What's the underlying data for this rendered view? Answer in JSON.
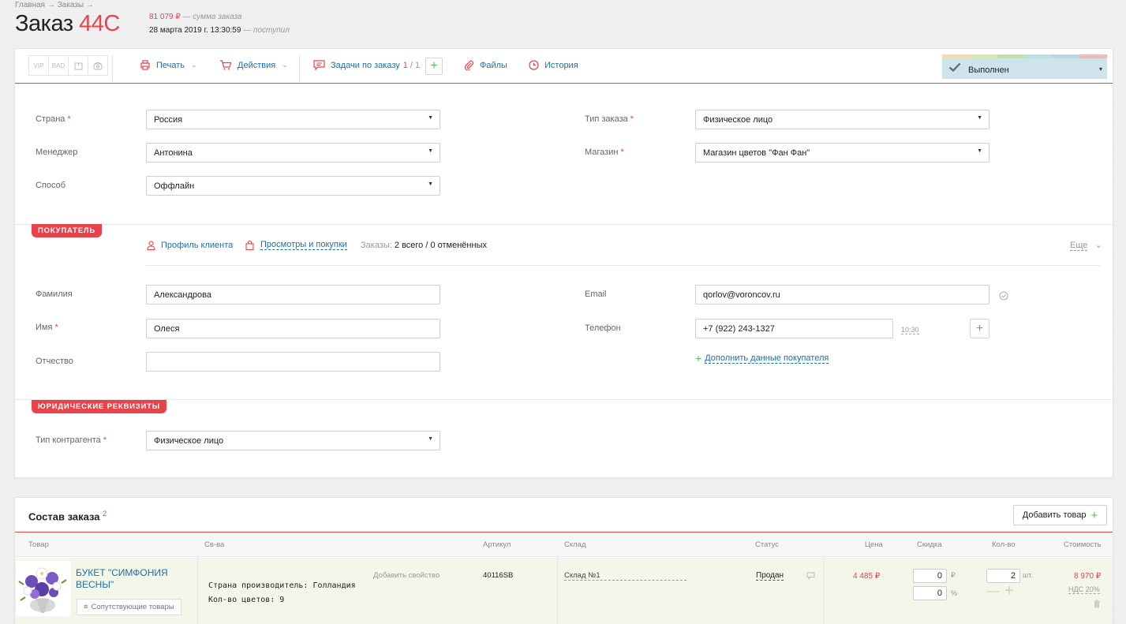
{
  "header": {
    "breadcrumb": "Главная → Заказы →",
    "title_prefix": "Заказ",
    "order_number": "44С",
    "order_sum": "81 079 ₽",
    "order_sum_note": "— сумма заказа",
    "created_date": "28 марта 2019 г. 13:30:59",
    "created_note": "— поступил"
  },
  "toolbar": {
    "badges": [
      "VIP",
      "BAD",
      "",
      ""
    ],
    "print_label": "Печать",
    "actions_label": "Действия",
    "tasks_label": "Задачи по заказу",
    "tasks_done": "1",
    "tasks_total": "/ 1",
    "add_task": "+",
    "files_label": "Файлы",
    "history_label": "История",
    "status_label": "Выполнен",
    "status_colors": [
      "#f3dfa3",
      "#dbe9a6",
      "#bfe3a3",
      "#b7e3dd",
      "#b8d8e6",
      "#f4b8bc"
    ]
  },
  "order_form": {
    "country_label": "Страна",
    "country_value": "Россия",
    "manager_label": "Менеджер",
    "manager_value": "Антонина",
    "method_label": "Способ",
    "method_value": "Оффлайн",
    "order_type_label": "Тип заказа",
    "order_type_value": "Физическое лицо",
    "shop_label": "Магазин",
    "shop_value": "Магазин цветов \"Фан Фан\"",
    "required_mark": "*"
  },
  "customer": {
    "section_title": "ПОКУПАТЕЛЬ",
    "profile_link": "Профиль клиента",
    "views_link": "Просмотры и покупки",
    "orders_label": "Заказы:",
    "orders_value": "2 всего / 0 отменённых",
    "more_label": "Еще",
    "lastname_label": "Фамилия",
    "lastname_value": "Александрова",
    "firstname_label": "Имя",
    "firstname_value": "Олеся",
    "patronymic_label": "Отчество",
    "patronymic_value": "",
    "email_label": "Email",
    "email_value": "qorlov@voroncov.ru",
    "phone_label": "Телефон",
    "phone_value": "+7 (922) 243-1327",
    "phone_time": "10:30",
    "add_phone": "+",
    "extra_data_link": "Дополнить данные покупателя",
    "extra_plus": "+"
  },
  "legal": {
    "section_title": "ЮРИДИЧЕСКИЕ РЕКВИЗИТЫ",
    "contractor_label": "Тип контрагента",
    "contractor_value": "Физическое лицо"
  },
  "order_items": {
    "title": "Состав заказа",
    "count": "2",
    "add_button": "Добавить товар",
    "columns": {
      "product": "Товар",
      "props": "Св-ва",
      "article": "Артикул",
      "warehouse": "Склад",
      "status": "Статус",
      "price": "Цена",
      "discount": "Скидка",
      "qty": "Кол-во",
      "cost": "Стоимость"
    },
    "rows": [
      {
        "name": "БУКЕТ \"СИМФОНИЯ ВЕСНЫ\"",
        "related_button": "Сопутствующие товары",
        "add_property": "Добавить свойство",
        "prop1": "Страна производитель: Голландия",
        "prop2": "Кол-во цветов: 9",
        "article": "40116SB",
        "warehouse": "Склад №1",
        "status": "Продан",
        "price": "4 485 ₽",
        "discount_rub": "0",
        "discount_rub_unit": "₽",
        "discount_pct": "0",
        "discount_pct_unit": "%",
        "qty": "2",
        "qty_unit": "шт.",
        "cost": "8 970 ₽",
        "vat": "НДС 20%"
      }
    ]
  }
}
